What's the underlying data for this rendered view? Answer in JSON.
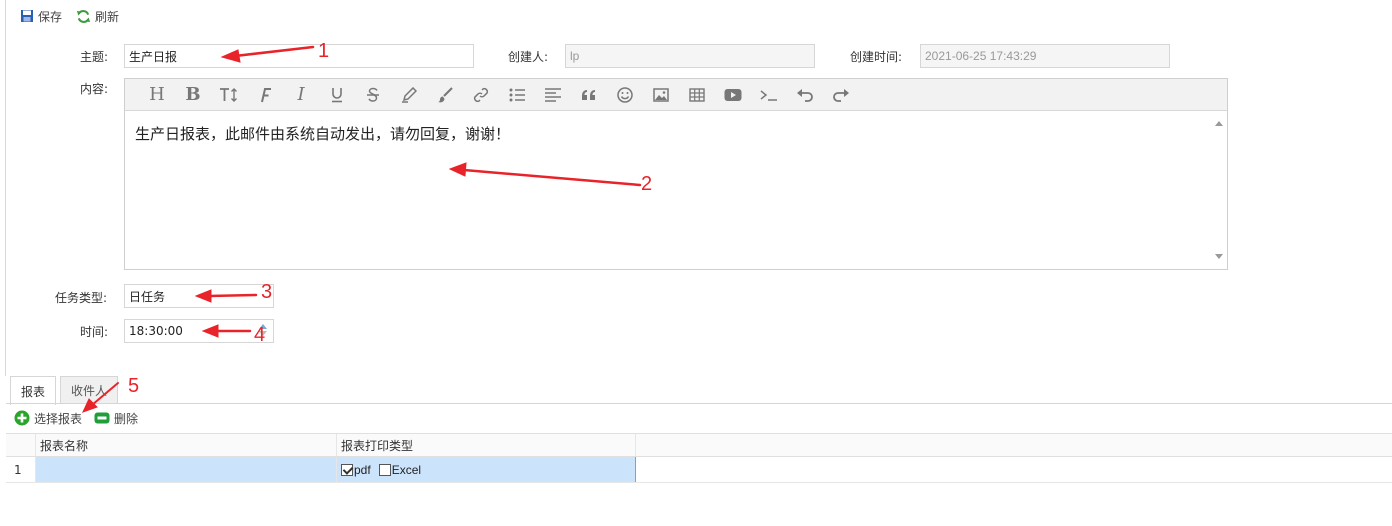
{
  "toolbar": {
    "save_label": "保存",
    "refresh_label": "刷新"
  },
  "form": {
    "subject_label": "主题:",
    "subject_value": "生产日报",
    "creator_label": "创建人:",
    "creator_value": "lp",
    "created_time_label": "创建时间:",
    "created_time_value": "2021-06-25 17:43:29",
    "content_label": "内容:",
    "content_text": "生产日报表，此邮件由系统自动发出，请勿回复，谢谢！",
    "task_type_label": "任务类型:",
    "task_type_value": "日任务",
    "time_label": "时间:",
    "time_value": "18:30:00"
  },
  "editor_tools": [
    "heading-icon",
    "bold-icon",
    "text-size-icon",
    "font-icon",
    "italic-icon",
    "underline-icon",
    "strikethrough-icon",
    "highlighter-icon",
    "brush-icon",
    "link-icon",
    "bulleted-list-icon",
    "align-left-icon",
    "blockquote-icon",
    "emoji-icon",
    "image-icon",
    "table-icon",
    "video-icon",
    "code-icon",
    "undo-icon",
    "redo-icon"
  ],
  "tabs": [
    {
      "label": "报表",
      "active": true
    },
    {
      "label": "收件人",
      "active": false
    }
  ],
  "report_toolbar": {
    "select_label": "选择报表",
    "delete_label": "删除"
  },
  "grid": {
    "headers": [
      "报表名称",
      "报表打印类型"
    ],
    "rows": [
      {
        "index": "1",
        "name": "",
        "options": [
          {
            "label": "pdf",
            "checked": true
          },
          {
            "label": "Excel",
            "checked": false
          }
        ]
      }
    ]
  },
  "annotations": [
    "1",
    "2",
    "3",
    "4",
    "5"
  ],
  "colors": {
    "annotation": "#e8242a",
    "selected_row": "#cce4fb",
    "save_icon": "#2b5fb4",
    "refresh_icon": "#3d9a3d",
    "add_icon": "#2aa52a"
  }
}
